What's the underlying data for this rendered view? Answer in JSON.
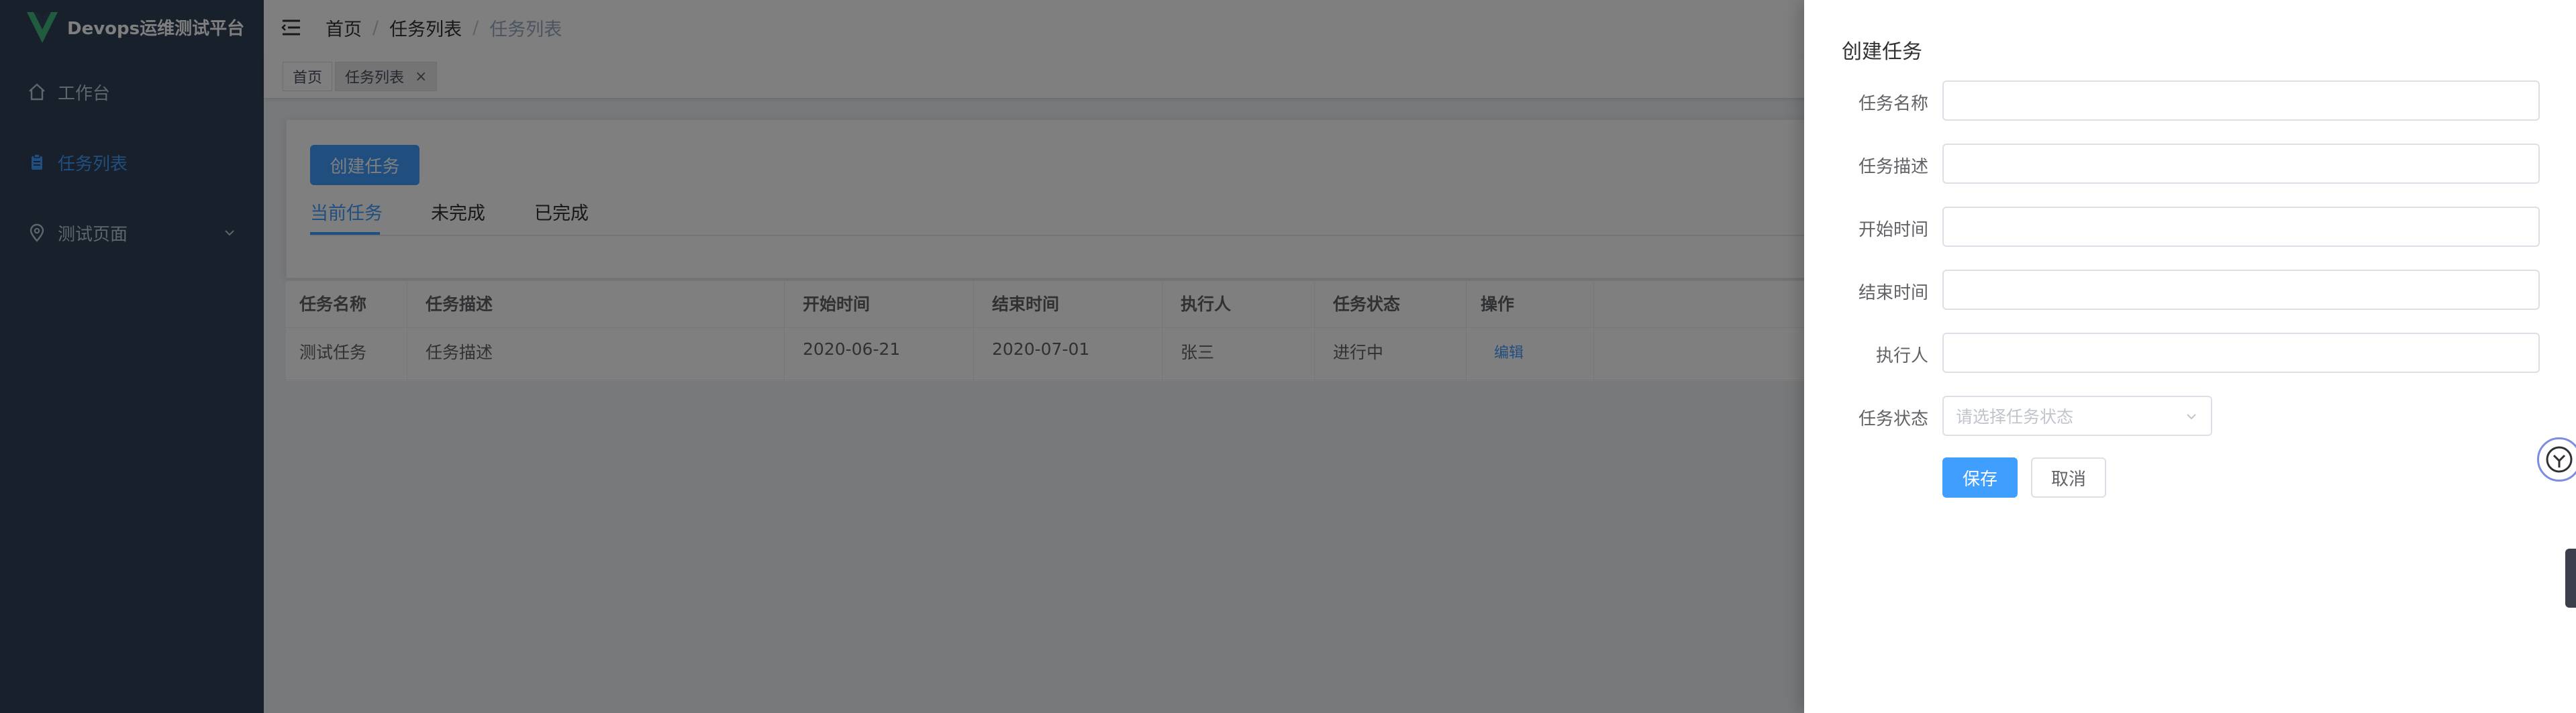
{
  "app": {
    "title": "Devops运维测试平台"
  },
  "sidebar": {
    "items": [
      {
        "label": "工作台",
        "icon": "home-icon"
      },
      {
        "label": "任务列表",
        "icon": "clipboard-icon",
        "active": true
      },
      {
        "label": "测试页面",
        "icon": "location-icon",
        "expandable": true
      }
    ]
  },
  "navbar": {
    "breadcrumb": [
      "首页",
      "任务列表",
      "任务列表"
    ]
  },
  "tags": [
    {
      "label": "首页",
      "active": false
    },
    {
      "label": "任务列表",
      "active": true,
      "closable": true
    }
  ],
  "page": {
    "create_button": "创建任务",
    "tabs": [
      "当前任务",
      "未完成",
      "已完成"
    ],
    "active_tab": 0,
    "table": {
      "columns": [
        "任务名称",
        "任务描述",
        "开始时间",
        "结束时间",
        "执行人",
        "任务状态",
        "操作"
      ],
      "rows": [
        [
          "测试任务",
          "任务描述",
          "2020-06-21",
          "2020-07-01",
          "张三",
          "进行中",
          "编辑"
        ]
      ]
    }
  },
  "drawer": {
    "title": "创建任务",
    "fields": [
      {
        "label": "任务名称",
        "value": ""
      },
      {
        "label": "任务描述",
        "value": ""
      },
      {
        "label": "开始时间",
        "value": ""
      },
      {
        "label": "结束时间",
        "value": ""
      },
      {
        "label": "执行人",
        "value": ""
      }
    ],
    "status_field": {
      "label": "任务状态",
      "placeholder": "请选择任务状态"
    },
    "save_label": "保存",
    "cancel_label": "取消"
  },
  "colors": {
    "sidebar_bg": "#304156",
    "accent": "#409eff",
    "overlay": "rgba(0,0,0,0.5)"
  }
}
